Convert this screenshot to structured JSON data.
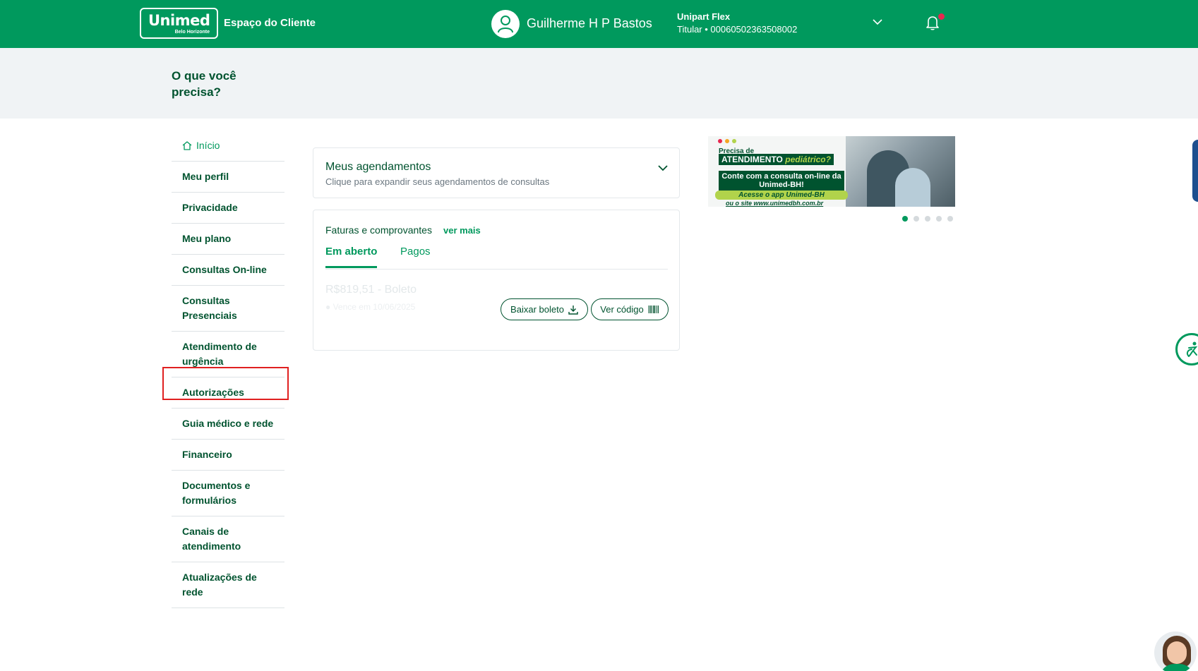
{
  "header": {
    "logo_text": "Unimed",
    "logo_sub": "Belo Horizonte",
    "title": "Espaço do Cliente",
    "user_name": "Guilherme H P Bastos",
    "plan_name": "Unipart Flex",
    "plan_id": "Titular • 00060502363508002",
    "brand_color": "#00995d",
    "notification_dot_color": "#e8264f"
  },
  "question": "O que você precisa?",
  "sidebar": {
    "items": [
      {
        "label": "Início",
        "icon": "home-icon"
      },
      {
        "label": "Meu perfil"
      },
      {
        "label": "Privacidade"
      },
      {
        "label": "Meu plano"
      },
      {
        "label": "Consultas On-line"
      },
      {
        "label": "Consultas Presenciais"
      },
      {
        "label": "Atendimento de urgência"
      },
      {
        "label": "Autorizações"
      },
      {
        "label": "Guia médico e rede"
      },
      {
        "label": "Financeiro"
      },
      {
        "label": "Documentos e formulários"
      },
      {
        "label": "Canais de atendimento"
      },
      {
        "label": "Atualizações de rede"
      }
    ],
    "highlighted": "Autorizações",
    "highlight_color": "#e02020"
  },
  "agendamentos": {
    "title": "Meus agendamentos",
    "subtitle": "Clique para expandir seus agendamentos de consultas"
  },
  "faturas": {
    "title": "Faturas e comprovantes",
    "link": "ver mais",
    "tabs": [
      "Em aberto",
      "Pagos"
    ],
    "active_tab": "Em aberto",
    "bill_amount": "R$819,51 - Boleto",
    "bill_due": "● Vence em 10/06/2025",
    "download_button": "Baixar boleto",
    "code_button": "Ver código"
  },
  "banner": {
    "line1": "Precisa de",
    "line2a": "ATENDIMENTO",
    "line2b": "pediátrico?",
    "line3": "Conte com a consulta on-line da Unimed-BH!",
    "line4": "Acesse o app Unimed-BH",
    "line5": "ou o site www.unimedbh.com.br",
    "slides": 5,
    "active_slide": 1
  }
}
